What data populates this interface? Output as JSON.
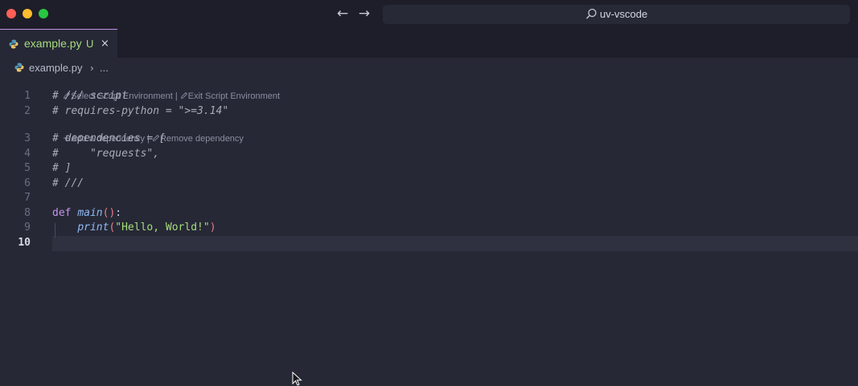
{
  "window": {
    "colors": {
      "close": "#fe5f57",
      "minimize": "#febc2e",
      "maximize": "#28c840"
    }
  },
  "titlebar": {
    "back_icon": "←",
    "forward_icon": "→",
    "search_text": "uv-vscode"
  },
  "tab": {
    "label": "example.py",
    "status": "U",
    "close_icon": "×",
    "accent": "#c693e6"
  },
  "breadcrumb": {
    "file": "example.py",
    "separator": "›",
    "more": "..."
  },
  "codelens": {
    "script_env": {
      "select": "Select Script Environment",
      "sep": " | ",
      "exit": "Exit Script Environment"
    },
    "dependency": {
      "add": "Add a dependency",
      "sep": " | ",
      "remove": "Remove dependency"
    }
  },
  "lines": [
    {
      "no": "1",
      "tokens": [
        {
          "t": "# /// script",
          "c": "cmt"
        }
      ]
    },
    {
      "no": "2",
      "tokens": [
        {
          "t": "# requires-python = \"",
          "c": "cmt"
        },
        {
          "t": ">=3.14",
          "c": "cmt"
        },
        {
          "t": "\"",
          "c": "cmt"
        }
      ]
    },
    {
      "no": "3",
      "tokens": [
        {
          "t": "# dependencies = [",
          "c": "cmt"
        }
      ]
    },
    {
      "no": "4",
      "tokens": [
        {
          "t": "#     \"requests\",",
          "c": "cmt"
        }
      ]
    },
    {
      "no": "5",
      "tokens": [
        {
          "t": "# ]",
          "c": "cmt"
        }
      ]
    },
    {
      "no": "6",
      "tokens": [
        {
          "t": "# ///",
          "c": "cmt"
        }
      ]
    },
    {
      "no": "7",
      "tokens": []
    },
    {
      "no": "8",
      "tokens": [
        {
          "t": "def ",
          "c": "kw"
        },
        {
          "t": "main",
          "c": "fn"
        },
        {
          "t": "()",
          "c": "pn"
        },
        {
          "t": ":",
          "c": "pl"
        }
      ]
    },
    {
      "no": "9",
      "tokens": [
        {
          "t": "    ",
          "c": "pl"
        },
        {
          "t": "print",
          "c": "fn"
        },
        {
          "t": "(",
          "c": "pn"
        },
        {
          "t": "\"Hello, World!\"",
          "c": "str"
        },
        {
          "t": ")",
          "c": "pn"
        }
      ]
    },
    {
      "no": "10",
      "tokens": [],
      "current": true
    }
  ]
}
